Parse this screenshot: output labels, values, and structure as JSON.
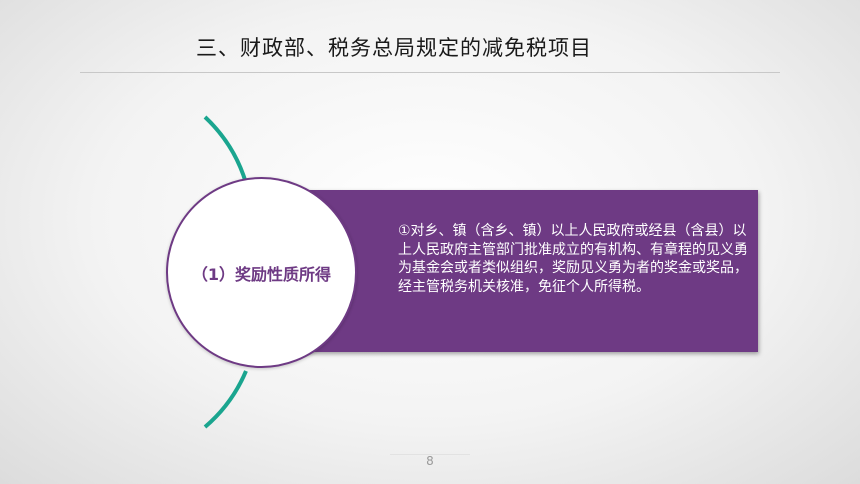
{
  "slide": {
    "title": "三、财政部、税务总局规定的减免税项目",
    "circle_label": "（1）奖励性质所得",
    "body_text": "①对乡、镇（含乡、镇）以上人民政府或经县（含县）以上人民政府主管部门批准成立的有机构、有章程的见义勇为基金会或者类似组织，奖励见义勇为者的奖金或奖品，经主管税务机关核准，免征个人所得税。",
    "page_number": "8"
  },
  "colors": {
    "accent_purple": "#6e3a84",
    "accent_teal": "#1aa58f"
  }
}
